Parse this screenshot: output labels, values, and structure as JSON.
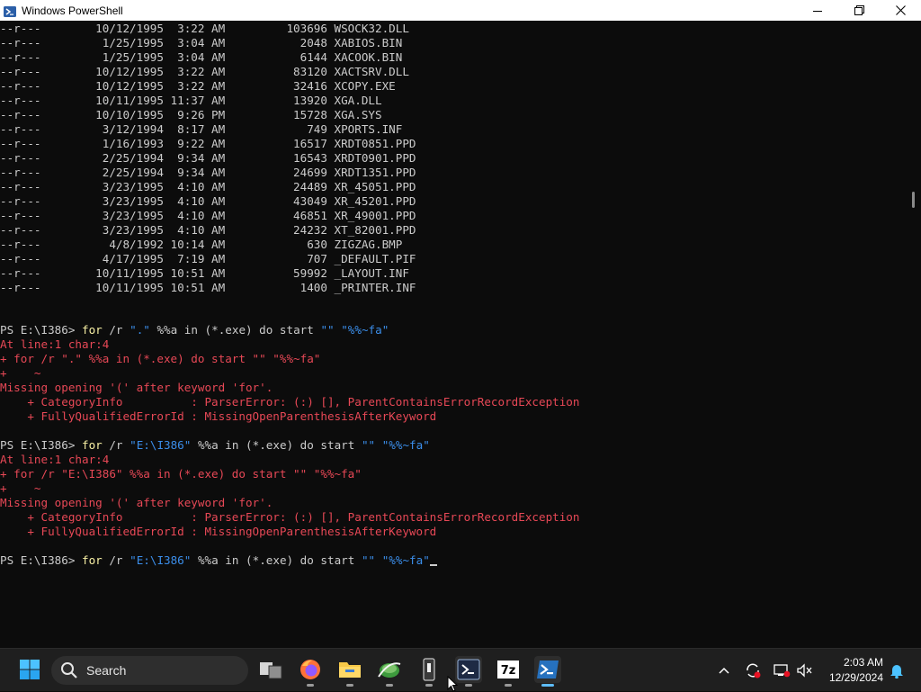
{
  "window": {
    "title": "Windows PowerShell"
  },
  "listing": [
    {
      "mode": "--r---",
      "date": "10/12/1995",
      "time": "3:22 AM",
      "size": "103696",
      "name": "WSOCK32.DLL"
    },
    {
      "mode": "--r---",
      "date": "1/25/1995",
      "time": "3:04 AM",
      "size": "2048",
      "name": "XABIOS.BIN"
    },
    {
      "mode": "--r---",
      "date": "1/25/1995",
      "time": "3:04 AM",
      "size": "6144",
      "name": "XACOOK.BIN"
    },
    {
      "mode": "--r---",
      "date": "10/12/1995",
      "time": "3:22 AM",
      "size": "83120",
      "name": "XACTSRV.DLL"
    },
    {
      "mode": "--r---",
      "date": "10/12/1995",
      "time": "3:22 AM",
      "size": "32416",
      "name": "XCOPY.EXE"
    },
    {
      "mode": "--r---",
      "date": "10/11/1995",
      "time": "11:37 AM",
      "size": "13920",
      "name": "XGA.DLL"
    },
    {
      "mode": "--r---",
      "date": "10/10/1995",
      "time": "9:26 PM",
      "size": "15728",
      "name": "XGA.SYS"
    },
    {
      "mode": "--r---",
      "date": "3/12/1994",
      "time": "8:17 AM",
      "size": "749",
      "name": "XPORTS.INF"
    },
    {
      "mode": "--r---",
      "date": "1/16/1993",
      "time": "9:22 AM",
      "size": "16517",
      "name": "XRDT0851.PPD"
    },
    {
      "mode": "--r---",
      "date": "2/25/1994",
      "time": "9:34 AM",
      "size": "16543",
      "name": "XRDT0901.PPD"
    },
    {
      "mode": "--r---",
      "date": "2/25/1994",
      "time": "9:34 AM",
      "size": "24699",
      "name": "XRDT1351.PPD"
    },
    {
      "mode": "--r---",
      "date": "3/23/1995",
      "time": "4:10 AM",
      "size": "24489",
      "name": "XR_45051.PPD"
    },
    {
      "mode": "--r---",
      "date": "3/23/1995",
      "time": "4:10 AM",
      "size": "43049",
      "name": "XR_45201.PPD"
    },
    {
      "mode": "--r---",
      "date": "3/23/1995",
      "time": "4:10 AM",
      "size": "46851",
      "name": "XR_49001.PPD"
    },
    {
      "mode": "--r---",
      "date": "3/23/1995",
      "time": "4:10 AM",
      "size": "24232",
      "name": "XT_82001.PPD"
    },
    {
      "mode": "--r---",
      "date": "4/8/1992",
      "time": "10:14 AM",
      "size": "630",
      "name": "ZIGZAG.BMP"
    },
    {
      "mode": "--r---",
      "date": "4/17/1995",
      "time": "7:19 AM",
      "size": "707",
      "name": "_DEFAULT.PIF"
    },
    {
      "mode": "--r---",
      "date": "10/11/1995",
      "time": "10:51 AM",
      "size": "59992",
      "name": "_LAYOUT.INF"
    },
    {
      "mode": "--r---",
      "date": "10/11/1995",
      "time": "10:51 AM",
      "size": "1400",
      "name": "_PRINTER.INF"
    }
  ],
  "session": {
    "prompt": "PS E:\\I386> ",
    "cmd1": {
      "for": "for",
      "flag": "/r",
      "path": "\".\"",
      "rest": "%%a in (*.exe) do start",
      "q1": "\"\"",
      "q2": "\"%%~fa\""
    },
    "err1": {
      "loc": "At line:1 char:4",
      "echo": "+ for /r \".\" %%a in (*.exe) do start \"\" \"%%~fa\"",
      "caret": "+    ~",
      "msg": "Missing opening '(' after keyword 'for'.",
      "cat": "    + CategoryInfo          : ParserError: (:) [], ParentContainsErrorRecordException",
      "fq": "    + FullyQualifiedErrorId : MissingOpenParenthesisAfterKeyword"
    },
    "cmd2": {
      "for": "for",
      "flag": "/r",
      "path": "\"E:\\I386\"",
      "rest": "%%a in (*.exe) do start",
      "q1": "\"\"",
      "q2": "\"%%~fa\""
    },
    "err2": {
      "loc": "At line:1 char:4",
      "echo": "+ for /r \"E:\\I386\" %%a in (*.exe) do start \"\" \"%%~fa\"",
      "caret": "+    ~",
      "msg": "Missing opening '(' after keyword 'for'.",
      "cat": "    + CategoryInfo          : ParserError: (:) [], ParentContainsErrorRecordException",
      "fq": "    + FullyQualifiedErrorId : MissingOpenParenthesisAfterKeyword"
    },
    "cmd3": {
      "for": "for",
      "flag": "/r",
      "path": "\"E:\\I386\"",
      "rest": "%%a in (*.exe) do start",
      "q1": "\"\"",
      "q2": "\"%%~fa\""
    }
  },
  "taskbar": {
    "search_label": "Search",
    "time": "2:03 AM",
    "date": "12/29/2024",
    "pinned": [
      "windows-start",
      "search",
      "task-view",
      "firefox",
      "file-explorer",
      "network-tool",
      "phone-link",
      "powershell-ise",
      "7zip",
      "powershell"
    ]
  },
  "colors": {
    "background": "#0c0c0c",
    "text": "#cccccc",
    "command": "#f9f1a5",
    "string": "#3b8eea",
    "error": "#e74856",
    "accent": "#5ebcf7"
  }
}
